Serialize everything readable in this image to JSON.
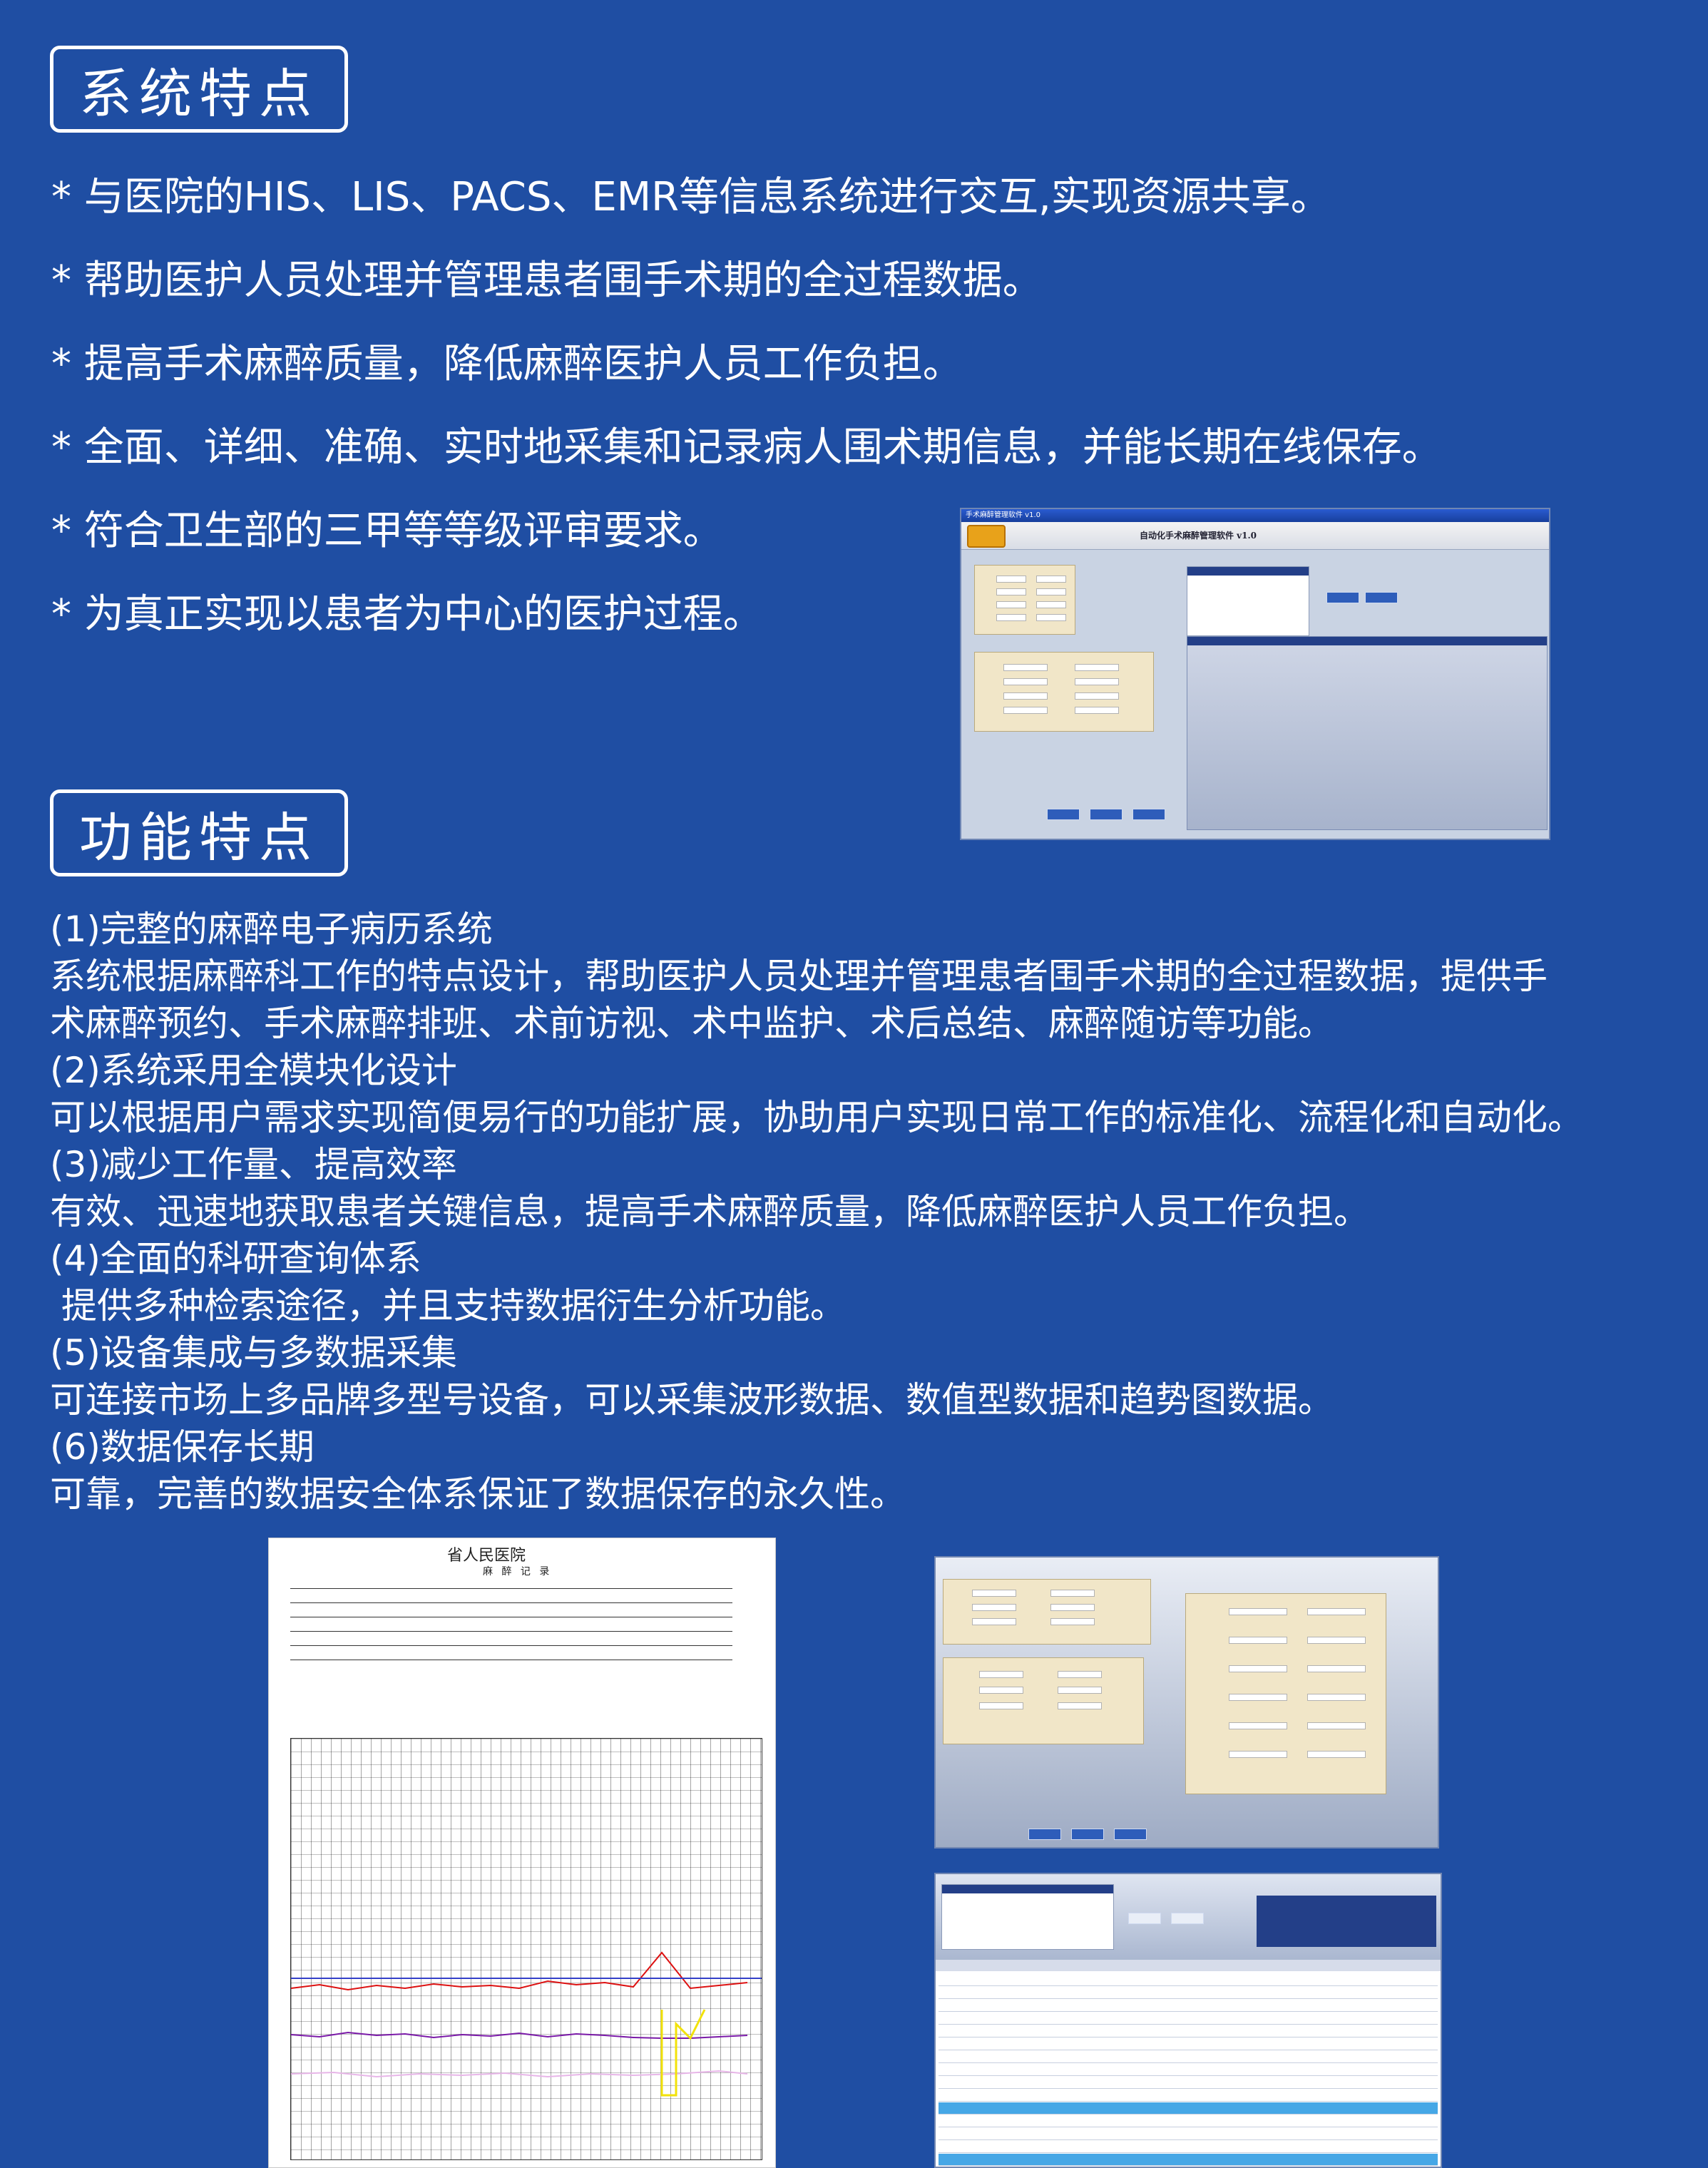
{
  "sections": {
    "features_title": "系统特点",
    "functions_title": "功能特点"
  },
  "features": [
    "* 与医院的HIS、LIS、PACS、EMR等信息系统进行交互,实现资源共享。",
    "* 帮助医护人员处理并管理患者围手术期的全过程数据。",
    "* 提高手术麻醉质量，降低麻醉医护人员工作负担。",
    "* 全面、详细、准确、实时地采集和记录病人围术期信息，并能长期在线保存。",
    "* 符合卫生部的三甲等等级评审要求。",
    "* 为真正实现以患者为中心的医护过程。"
  ],
  "functions": [
    {
      "title": "(1)完整的麻醉电子病历系统",
      "desc": [
        "系统根据麻醉科工作的特点设计，帮助医护人员处理并管理患者围手术期的全过程数据，提供手",
        "术麻醉预约、手术麻醉排班、术前访视、术中监护、术后总结、麻醉随访等功能。"
      ]
    },
    {
      "title": "(2)系统采用全模块化设计",
      "desc": [
        "可以根据用户需求实现简便易行的功能扩展，协助用户实现日常工作的标准化、流程化和自动化。"
      ]
    },
    {
      "title": "(3)减少工作量、提高效率",
      "desc": [
        "有效、迅速地获取患者关键信息，提高手术麻醉质量，降低麻醉医护人员工作负担。"
      ]
    },
    {
      "title": "(4)全面的科研查询体系",
      "desc": [
        " 提供多种检索途径，并且支持数据衍生分析功能。"
      ]
    },
    {
      "title": "(5)设备集成与多数据采集",
      "desc": [
        "可连接市场上多品牌多型号设备，可以采集波形数据、数值型数据和趋势图数据。"
      ]
    },
    {
      "title": "(6)数据保存长期",
      "desc": [
        "可靠，完善的数据安全体系保证了数据保存的永久性。"
      ]
    }
  ],
  "screenshots": {
    "main_window": {
      "window_title": "手术麻醉管理软件 v1.0",
      "app_title": "自动化手术麻醉管理软件 v1.0"
    },
    "anesthesia_record": {
      "hospital": "省人民医院",
      "form_title": "麻 醉 记 录"
    }
  }
}
